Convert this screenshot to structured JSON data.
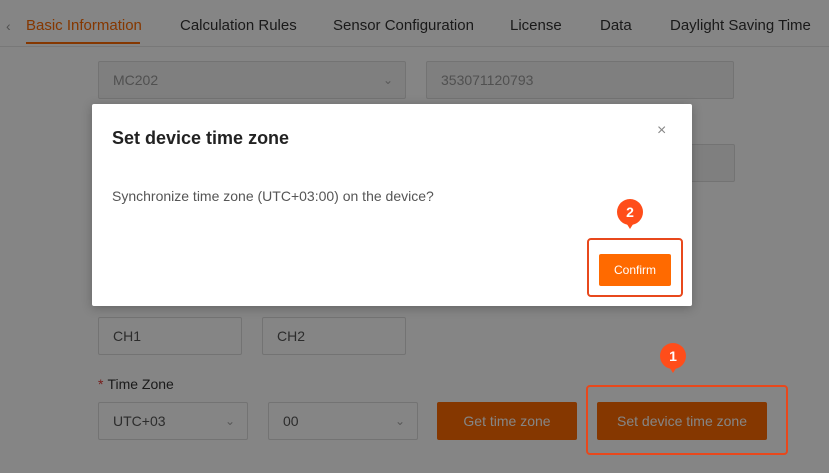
{
  "tabs": {
    "back_icon": "chevron-left-icon",
    "items": [
      {
        "label": "Basic Information",
        "active": true
      },
      {
        "label": "Calculation Rules"
      },
      {
        "label": "Sensor Configuration"
      },
      {
        "label": "License"
      },
      {
        "label": "Data"
      },
      {
        "label": "Daylight Saving Time"
      }
    ]
  },
  "form": {
    "model_value": "MC202",
    "serial_value": "353071120793",
    "channel1_value": "CH1",
    "channel2_value": "CH2",
    "timezone_label": "Time Zone",
    "required_mark": "*",
    "timezone_value": "UTC+03",
    "minutes_value": "00",
    "get_timezone_label": "Get time zone",
    "set_timezone_label": "Set device time zone"
  },
  "dialog": {
    "title": "Set device time zone",
    "close_glyph": "×",
    "message": "Synchronize time zone (UTC+03:00) on the device?",
    "confirm_label": "Confirm"
  },
  "annotations": {
    "step1": "1",
    "step2": "2"
  },
  "colors": {
    "accent": "#ff6a00",
    "highlight": "#e8481c"
  }
}
